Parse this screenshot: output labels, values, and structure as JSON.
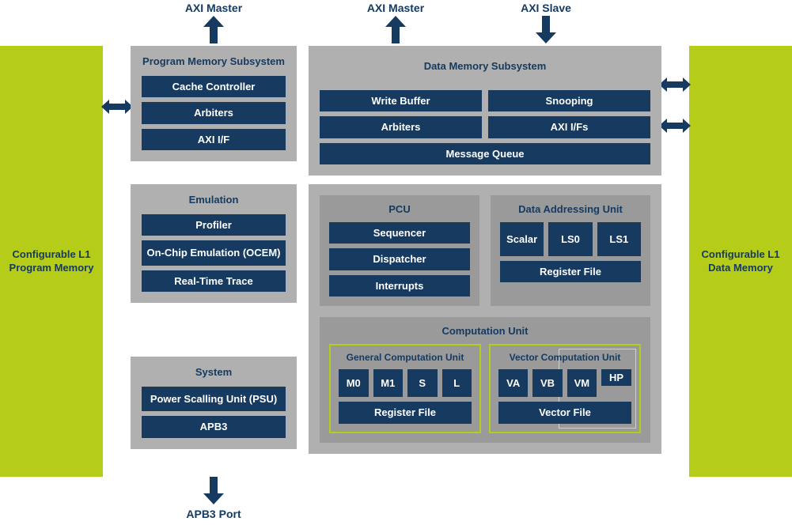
{
  "top": {
    "axi_master_1": "AXI Master",
    "axi_master_2": "AXI Master",
    "axi_slave": "AXI Slave"
  },
  "bottom": {
    "apb3_port": "APB3 Port"
  },
  "sides": {
    "left": "Configurable L1 Program Memory",
    "right": "Configurable L1 Data Memory"
  },
  "prog_mem": {
    "title": "Program Memory Subsystem",
    "cache_controller": "Cache Controller",
    "arbiters": "Arbiters",
    "axi_if": "AXI I/F"
  },
  "data_mem": {
    "title": "Data Memory Subsystem",
    "write_buffer": "Write Buffer",
    "snooping": "Snooping",
    "arbiters": "Arbiters",
    "axi_ifs": "AXI I/Fs",
    "message_queue": "Message Queue"
  },
  "emulation": {
    "title": "Emulation",
    "profiler": "Profiler",
    "ocem": "On-Chip Emulation (OCEM)",
    "realtime_trace": "Real-Time Trace"
  },
  "system": {
    "title": "System",
    "psu": "Power Scalling Unit (PSU)",
    "apb3": "APB3"
  },
  "pcu": {
    "title": "PCU",
    "sequencer": "Sequencer",
    "dispatcher": "Dispatcher",
    "interrupts": "Interrupts"
  },
  "dau": {
    "title": "Data Addressing Unit",
    "scalar": "Scalar",
    "ls0": "LS0",
    "ls1": "LS1",
    "register_file": "Register File"
  },
  "cu": {
    "title": "Computation Unit",
    "gcu": {
      "title": "General Computation Unit",
      "m0": "M0",
      "m1": "M1",
      "s": "S",
      "l": "L",
      "register_file": "Register File"
    },
    "vcu": {
      "title": "Vector Computation Unit",
      "va": "VA",
      "vb": "VB",
      "vm": "VM",
      "hp": "HP",
      "vector_file": "Vector File"
    }
  }
}
